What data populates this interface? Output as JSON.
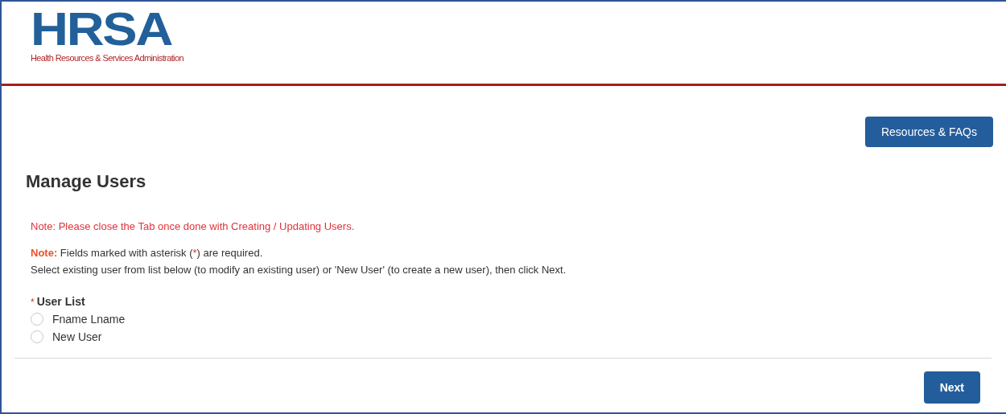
{
  "header": {
    "logo": "HRSA",
    "logo_subtitle": "Health Resources & Services Administration"
  },
  "resources_button": "Resources & FAQs",
  "page_title": "Manage Users",
  "tab_note": "Note: Please close the Tab once done with Creating / Updating Users.",
  "required_note": {
    "label": "Note:",
    "before": " Fields marked with asterisk (",
    "mark": "*",
    "after": ") are required."
  },
  "instructions": "Select existing user from list below (to modify an existing user) or 'New User' (to create a new user), then click Next.",
  "user_list": {
    "required_mark": "*",
    "label": "User List",
    "options": [
      {
        "label": "Fname Lname",
        "selected": false
      },
      {
        "label": "New User",
        "selected": false
      }
    ]
  },
  "next_button": "Next"
}
